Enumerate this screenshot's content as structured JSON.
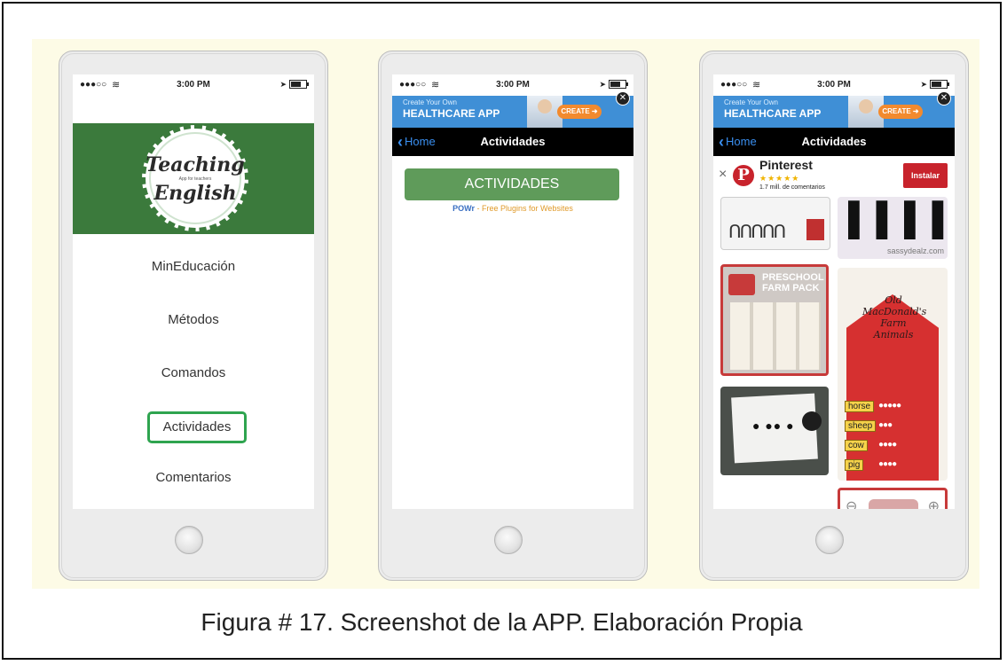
{
  "status_bar": {
    "signal": "●●●○○",
    "wifi": "≋",
    "time": "3:00 PM",
    "location_arrow": "➤"
  },
  "phone1": {
    "logo": {
      "line1": "Teaching",
      "tagline": "App for teachers",
      "line2": "English"
    },
    "menu": [
      "MinEducación",
      "Métodos",
      "Comandos",
      "Actividades",
      "Comentarios"
    ],
    "active_index": 3
  },
  "ad_banner": {
    "line1": "Create Your Own",
    "line2": "HEALTHCARE APP",
    "button": "CREATE ➜",
    "close": "✕"
  },
  "navbar": {
    "back_label": "Home",
    "title": "Actividades"
  },
  "phone2": {
    "button_label": "ACTIVIDADES",
    "powr_brand": "POWr",
    "powr_tail": " - Free Plugins for Websites"
  },
  "phone3": {
    "pinterest_ad": {
      "close": "×",
      "logo": "P",
      "name": "Pinterest",
      "stars": "★★★★★",
      "reviews": "1.7 mill. de comentarios",
      "install": "Instalar"
    },
    "tiles": {
      "sassy_source": "sassydealz.com",
      "preschool_title": "PRESCHOOL FARM PACK",
      "barn_text": "Old MacDonald's Farm Animals",
      "animals": [
        "horse",
        "sheep",
        "cow",
        "pig"
      ],
      "zoom_out": "⊖",
      "zoom_in": "⊕"
    }
  },
  "caption": "Figura # 17. Screenshot de la APP. Elaboración Propia",
  "colors": {
    "panel_bg": "#fdfbe6",
    "green_banner": "#3b7a3c",
    "active_border": "#2ea44f",
    "actividades_button": "#5f9b5a",
    "pinterest_red": "#c8232c",
    "ios_blue": "#3a8ff0"
  }
}
